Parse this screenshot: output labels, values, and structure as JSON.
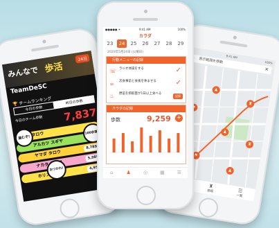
{
  "left_app": {
    "banner_title": "みんなで",
    "banner_highlight": "歩活",
    "banner_tag": "24日",
    "team_name": "TeamDeSC",
    "ranking_label": "チームランキング",
    "tabs": [
      "今日の歩数",
      "昨日の歩数"
    ],
    "today_label": "今日のチーム歩数",
    "team_steps": "7,837",
    "members": [
      {
        "name": "タロウ",
        "steps": "",
        "color": "#ffe24a"
      },
      {
        "name": "アルカツ スギヤ",
        "steps": "",
        "color": "#9be15d"
      },
      {
        "name": "ヤマダ タロウ",
        "steps": "8,789",
        "color": "#ffd23a"
      },
      {
        "name": "ナカタ ヤスコ",
        "steps": "5,989",
        "color": "#f7a7c9"
      },
      {
        "name": "ホリスカ",
        "steps": "4,954",
        "color": "#ffe24a"
      }
    ],
    "badges": [
      "進むぞ!",
      "100歩達成",
      "おつかれ!"
    ]
  },
  "mid_app": {
    "status": {
      "carrier": "●●●●● ✈",
      "time": "9:41 AM",
      "battery": "100%"
    },
    "title": "カラダ",
    "dates": [
      "23",
      "24",
      "25",
      "26",
      "27",
      "28",
      "29"
    ],
    "selected_date_index": 1,
    "date_line": "2020年5月24日 (火曜日)",
    "menu_title": "行動メニューの記録",
    "menu_items": [
      {
        "text": "ラジオ体操をする",
        "done": true,
        "action": ""
      },
      {
        "text": "次食事前と食後を休ませる",
        "done": true,
        "action": ""
      },
      {
        "text": "野菜を摂取量が1日以上食べる",
        "done": false,
        "action": "記録"
      }
    ],
    "body_title": "カラダの記録",
    "steps_label": "歩数",
    "steps_value": "9,259",
    "steps_unit": "歩",
    "tabbar": [
      "⌂",
      "♟",
      "◎",
      "▦",
      "☰"
    ],
    "active_tab_index": 1
  },
  "mid_chart": {
    "chart_data": {
      "type": "bar",
      "categories": [
        "",
        "",
        "",
        "",
        "",
        "",
        "",
        ""
      ],
      "values": [
        5,
        7,
        4,
        9,
        6,
        8,
        5,
        7
      ],
      "color": "#f0632a",
      "title": "",
      "xlabel": "",
      "ylabel": ""
    }
  },
  "right_app": {
    "status": {
      "time": "9:41 AM",
      "battery": "100%"
    },
    "search_placeholder": "表示範囲を移動",
    "nav": [
      {
        "icon": "♟",
        "label": "歩く"
      },
      {
        "icon": "♜",
        "label": "施設"
      },
      {
        "icon": "☰",
        "label": "一覧"
      }
    ]
  }
}
